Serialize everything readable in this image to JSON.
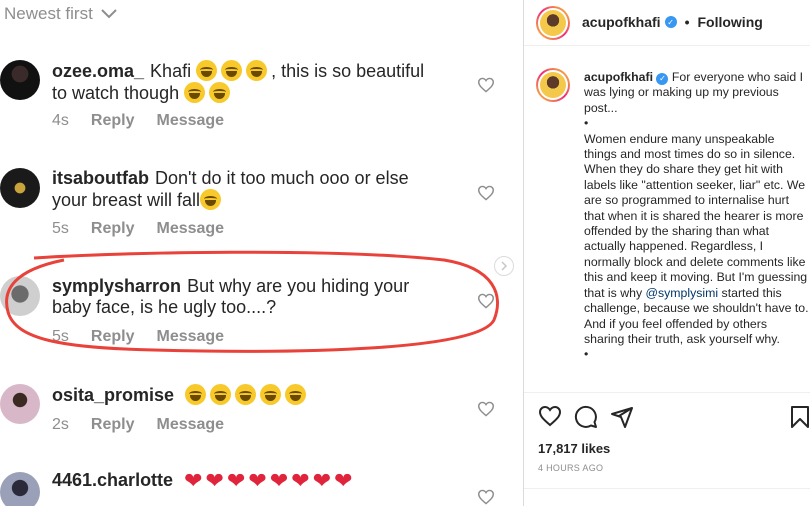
{
  "sort": {
    "label": "Newest first"
  },
  "comments": [
    {
      "user": "ozee.oma_",
      "text_before": "Khafi",
      "emoji_laugh_count_1": 3,
      "text_mid": ", this is so beautiful",
      "text_line2": "to watch though",
      "time": "4s",
      "reply": "Reply",
      "message": "Message"
    },
    {
      "user": "itsaboutfab",
      "text_line1": "Don't do it too much ooo or else",
      "text_line2": "your breast will fall",
      "time": "5s",
      "reply": "Reply",
      "message": "Message"
    },
    {
      "user": "symplysharron",
      "text_line1": "But why are you hiding your",
      "text_line2": "baby face, is he ugly too....?",
      "time": "5s",
      "reply": "Reply",
      "message": "Message"
    },
    {
      "user": "osita_promise",
      "time": "2s",
      "reply": "Reply",
      "message": "Message"
    },
    {
      "user": "4461.charlotte"
    }
  ],
  "post": {
    "username": "acupofkhafi",
    "follow_status": "Following",
    "caption_user": "acupofkhafi",
    "caption_p1": "For everyone who said I was lying or making up my previous post...",
    "bullet": "•",
    "caption_p2": "Women endure many unspeakable things and most times do so in silence. When they do share they get hit with labels like \"attention seeker, liar\" etc. We are so programmed to internalise hurt that when it is shared the hearer is more offended by the sharing than what actually happened. Regardless, I normally block and delete comments like this and keep it moving. But I'm guessing that is why",
    "mention": "@symplysimi",
    "caption_p3": "started this challenge, because we shouldn't have to. And if you feel offended by others sharing their truth, ask yourself why.",
    "likes": "17,817 likes",
    "time_ago": "4 HOURS AGO"
  },
  "colors": {
    "annotation": "#e8423a",
    "link": "#00376b",
    "verified": "#3897f0"
  }
}
